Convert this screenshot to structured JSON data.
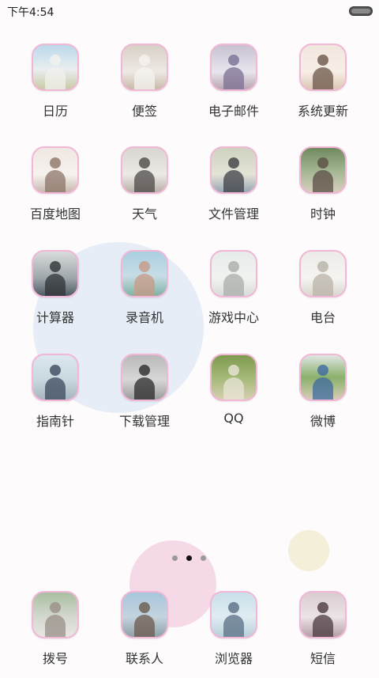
{
  "status_bar": {
    "time": "下午4:54"
  },
  "apps": [
    {
      "label": "日历",
      "icon": "calendar-app-icon",
      "bg": "linear-gradient(180deg,#bcd8ea 0%,#e9eef0 55%,#c9c9a4 100%)",
      "accent": "#f2f2ee"
    },
    {
      "label": "便签",
      "icon": "notes-app-icon",
      "bg": "linear-gradient(180deg,#d8d0c6 0%,#ede9e4 60%,#c8b9a8 100%)",
      "accent": "#f6f4f0"
    },
    {
      "label": "电子邮件",
      "icon": "email-app-icon",
      "bg": "linear-gradient(180deg,#c8c2d0 0%,#e9e5ee 60%,#b8a6b0 100%)",
      "accent": "#7b6f93"
    },
    {
      "label": "系统更新",
      "icon": "system-update-app-icon",
      "bg": "linear-gradient(180deg,#f1e7de 0%,#f7eee6 60%,#dcc6b4 100%)",
      "accent": "#6b5648"
    },
    {
      "label": "百度地图",
      "icon": "baidu-map-app-icon",
      "bg": "linear-gradient(180deg,#efe7e2 0%,#f6f2ef 60%,#c9b8ae 100%)",
      "accent": "#8c7468"
    },
    {
      "label": "天气",
      "icon": "weather-app-icon",
      "bg": "linear-gradient(180deg,#d9d6d2 0%,#ece9e5 60%,#b7b0a7 100%)",
      "accent": "#4d4a48"
    },
    {
      "label": "文件管理",
      "icon": "file-manager-app-icon",
      "bg": "linear-gradient(180deg,#cfd2c0 0%,#e3e3d6 60%,#97a6b4 100%)",
      "accent": "#3e3f45"
    },
    {
      "label": "时钟",
      "icon": "clock-app-icon",
      "bg": "linear-gradient(180deg,#6f8a5f 0%,#a7b896 55%,#d7cfbd 100%)",
      "accent": "#5a4e44"
    },
    {
      "label": "计算器",
      "icon": "calculator-app-icon",
      "bg": "linear-gradient(180deg,#d9dcdc 0%,#9ea6aa 60%,#4e5a63 100%)",
      "accent": "#2f3336"
    },
    {
      "label": "录音机",
      "icon": "recorder-app-icon",
      "bg": "linear-gradient(180deg,#a9cfe0 0%,#c7dde6 55%,#7fb2a3 100%)",
      "accent": "#c89a86"
    },
    {
      "label": "游戏中心",
      "icon": "game-center-app-icon",
      "bg": "linear-gradient(180deg,#e6ece9 0%,#f1f3f1 60%,#d8ddd9 100%)",
      "accent": "#a9aea9"
    },
    {
      "label": "电台",
      "icon": "radio-app-icon",
      "bg": "linear-gradient(180deg,#ecebe7 0%,#f5f4f1 60%,#dad7cf 100%)",
      "accent": "#b9b3a8"
    },
    {
      "label": "指南针",
      "icon": "compass-app-icon",
      "bg": "linear-gradient(180deg,#dce8ee 0%,#c9d8df 55%,#a8b7bf 100%)",
      "accent": "#3b4a5c"
    },
    {
      "label": "下载管理",
      "icon": "download-manager-app-icon",
      "bg": "linear-gradient(180deg,#b9b9b9 0%,#d7d7d7 55%,#9c9c9c 100%)",
      "accent": "#2b2b2b"
    },
    {
      "label": "QQ",
      "icon": "qq-app-icon",
      "bg": "linear-gradient(180deg,#7f9a4f 0%,#a8bb7d 55%,#d6cfb0 100%)",
      "accent": "#e9e5d8"
    },
    {
      "label": "微博",
      "icon": "weibo-app-icon",
      "bg": "linear-gradient(180deg,#dfe6e2 0%,#8ab06a 50%,#d8cdb8 100%)",
      "accent": "#3e6aa0"
    }
  ],
  "dock": [
    {
      "label": "拨号",
      "icon": "phone-app-icon",
      "bg": "linear-gradient(180deg,#a9bfa1 0%,#d4d8cf 55%,#e8e6e3 100%)",
      "accent": "#9a8f88"
    },
    {
      "label": "联系人",
      "icon": "contacts-app-icon",
      "bg": "linear-gradient(180deg,#a7c6dc 0%,#c4d4de 55%,#8fa0a8 100%)",
      "accent": "#6b5a4e"
    },
    {
      "label": "浏览器",
      "icon": "browser-app-icon",
      "bg": "linear-gradient(180deg,#c9dfe9 0%,#e0ecf2 55%,#b9cfd9 100%)",
      "accent": "#5a6f85"
    },
    {
      "label": "短信",
      "icon": "messages-app-icon",
      "bg": "linear-gradient(180deg,#d9ccd1 0%,#ebe3e5 55%,#b79fa8 100%)",
      "accent": "#4b3a3f"
    }
  ],
  "pager": {
    "active_index": 1,
    "count": 3,
    "active_color": "#111111",
    "inactive_color": "#9a9a9a"
  }
}
